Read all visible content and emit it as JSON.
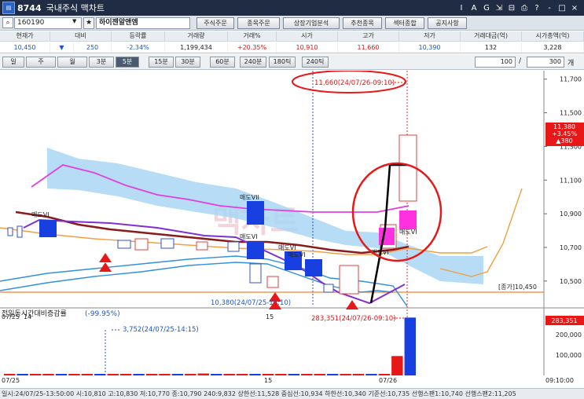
{
  "window": {
    "number": "8744",
    "title": "국내주식 맥차트",
    "buttons": [
      "I",
      "A",
      "G",
      "⇲",
      "⊟",
      "⎙",
      "?",
      "-",
      "□",
      "×"
    ]
  },
  "toolbar": {
    "code": "160190",
    "name": "하이젠알앤엠",
    "buttons": [
      "주식주문",
      "종목주문",
      "상장기업분석",
      "추천종목",
      "섹터종합",
      "공지사항"
    ]
  },
  "quote": {
    "headers": [
      "현재가",
      "대비",
      "등락률",
      "거래량",
      "거래%",
      "시가",
      "고가",
      "저가",
      "거래대금(억)",
      "시가총액(억)"
    ],
    "values": [
      "10,450",
      "250",
      "-2.34%",
      "1,199,434",
      "+20.35%",
      "10,910",
      "11,660",
      "10,390",
      "132",
      "3,228"
    ],
    "change_arrow": "▼"
  },
  "timeframes": {
    "items": [
      "일",
      "주",
      "월",
      "3분",
      "5분",
      "15분",
      "30분",
      "60분",
      "240분",
      "180틱",
      "240틱"
    ],
    "active_index": 4,
    "count": "100",
    "separator": "/",
    "total": "300",
    "unit": "개"
  },
  "chart_data": [
    {
      "type": "candlestick",
      "panel": "price",
      "y_ticks": [
        "11,700",
        "11,500",
        "11,300",
        "11,100",
        "10,900",
        "10,700",
        "10,500"
      ],
      "x_labels": [
        "07/25",
        "14",
        "15",
        "07/26"
      ],
      "ylim": [
        10350,
        11750
      ],
      "price_label": [
        "11,380",
        "+3.45%",
        "▲380"
      ],
      "current_label": "[종가]10,450",
      "annotation_high": "11,660(24/07/26-09:10)",
      "annotation_low": "10,380(24/07/25-15:10)",
      "signals": [
        "매도VI",
        "매도VII",
        "매도VI",
        "매도VI",
        "매도VI",
        "매도VI",
        "매도VI"
      ],
      "watermark": "맥차트"
    },
    {
      "type": "bar",
      "panel": "volume",
      "title": "전일동시간대비증감률",
      "title_value": "(-99.95%)",
      "y_ticks": [
        "200,000",
        "100,000"
      ],
      "ylim": [
        0,
        300000
      ],
      "annotation_high": "283,351(24/07/26-09:10)",
      "annotation_mid": "3,752(24/07/25-14:15)",
      "current_label": "283,351",
      "x_axis_end": "09:10:00",
      "values": [
        3200,
        2800,
        3500,
        3000,
        2600,
        2900,
        3100,
        2700,
        3300,
        3000,
        4200,
        3800,
        5200,
        4100,
        6800,
        9500,
        5100,
        7200,
        6100,
        5800,
        6500,
        5400,
        4800,
        5100,
        5600,
        4900,
        5200,
        6000,
        5000,
        4400,
        95000,
        283351
      ]
    }
  ],
  "status": "일시:24/07/25-13:50:00 시:10,810 고:10,830 저:10,770 종:10,790 240:9,832 상한선:11,528 중심선:10,934 하한선:10,340 기준선:10,735 선행스팬1:10,740 선행스팬2:11,205"
}
